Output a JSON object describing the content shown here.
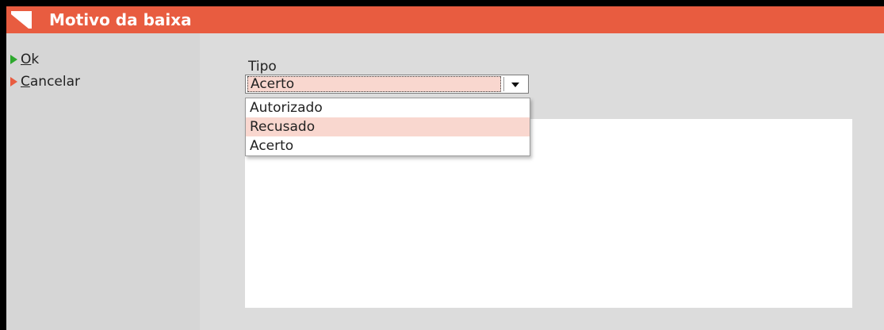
{
  "window": {
    "title": "Motivo da baixa",
    "logo_icon": "brand-logo-icon",
    "accent_color": "#e85c40"
  },
  "sidebar": {
    "actions": [
      {
        "first": "O",
        "rest": "k",
        "icon": "play-triangle-green-icon",
        "color": "#2ea82e"
      },
      {
        "first": "C",
        "rest": "ancelar",
        "icon": "play-triangle-orange-icon",
        "color": "#e85c40"
      }
    ]
  },
  "form": {
    "tipo_label": "Tipo",
    "tipo_value": "Acerto",
    "dropdown_icon": "chevron-down-icon",
    "options": [
      "Autorizado",
      "Recusado",
      "Acerto"
    ],
    "highlighted_option": "Recusado",
    "highlight_color": "#f9d7cf"
  }
}
